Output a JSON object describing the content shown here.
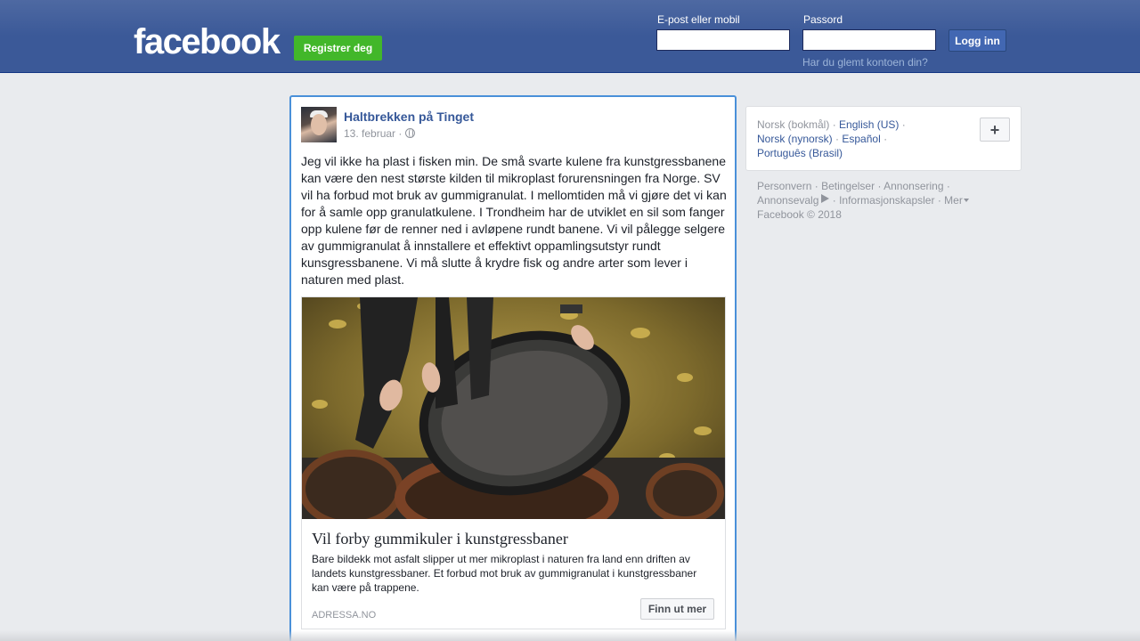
{
  "header": {
    "logo_text": "facebook",
    "register_label": "Registrer deg",
    "email_label": "E-post eller mobil",
    "email_value": "",
    "password_label": "Passord",
    "password_value": "",
    "login_label": "Logg inn",
    "forgot_label": "Har du glemt kontoen din?"
  },
  "post": {
    "author": "Haltbrekken på Tinget",
    "date": "13. februar",
    "date_sep": "·",
    "privacy_icon": "globe-icon",
    "text": "Jeg vil ikke ha plast i fisken min. De små svarte kulene fra kunstgressbanene kan være den nest største kilden til mikroplast forurensningen fra Norge. SV vil ha forbud mot bruk av gummigranulat. I mellomtiden må vi gjøre det vi kan for å samle opp granulatkulene. I Trondheim har de utviklet en sil som fanger opp kulene før de renner ned i avløpene rundt banene. Vi vil pålegge selgere av gummigranulat å innstallere et effektivt oppamlingsutstyr rundt kunsgressbanene. Vi må slutte å krydre fisk og andre arter som lever i naturen med plast.",
    "link": {
      "title": "Vil forby gummikuler i kunstgressbaner",
      "description": "Bare bildekk mot asfalt slipper ut mer mikroplast i naturen fra land enn driften av landets kunstgressbaner. Et forbud mot bruk av gummigranulat i kunstgressbaner kan være på trappene.",
      "domain": "ADRESSA.NO",
      "cta_label": "Finn ut mer"
    }
  },
  "sidebar": {
    "languages": {
      "current": "Norsk (bokmål)",
      "items": [
        "English (US)",
        "Norsk (nynorsk)",
        "Español",
        "Português (Brasil)"
      ],
      "separator": "·",
      "more_label": "+"
    },
    "footer": {
      "links": [
        "Personvern",
        "Betingelser",
        "Annonsering",
        "Annonsevalg",
        "Informasjonskapsler",
        "Mer"
      ],
      "separator": "·",
      "copyright": "Facebook © 2018"
    }
  },
  "colors": {
    "brand_blue": "#3b5998",
    "link_blue": "#365899",
    "register_green": "#42b72a",
    "page_bg": "#e9ebee"
  }
}
